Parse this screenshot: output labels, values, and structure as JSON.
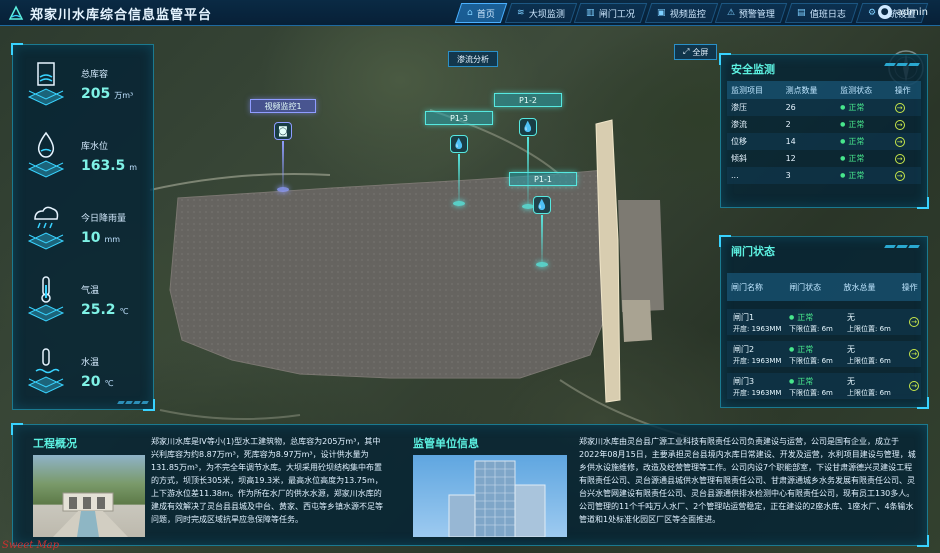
{
  "header": {
    "title": "郑家川水库综合信息监管平台",
    "nav": [
      {
        "label": "首页",
        "icon": "home-icon",
        "active": true
      },
      {
        "label": "大坝监测",
        "icon": "dam-icon",
        "active": false
      },
      {
        "label": "闸门工况",
        "icon": "gate-icon",
        "active": false
      },
      {
        "label": "视频监控",
        "icon": "video-icon",
        "active": false
      },
      {
        "label": "预警管理",
        "icon": "alarm-icon",
        "active": false
      },
      {
        "label": "值班日志",
        "icon": "log-icon",
        "active": false
      },
      {
        "label": "系统设置",
        "icon": "gear-icon",
        "active": false
      }
    ],
    "user": "admin"
  },
  "stats": [
    {
      "label": "总库容",
      "value": "205",
      "unit": "万m³",
      "icon": "reservoir-icon"
    },
    {
      "label": "库水位",
      "value": "163.5",
      "unit": "m",
      "icon": "water-level-icon"
    },
    {
      "label": "今日降雨量",
      "value": "10",
      "unit": "mm",
      "icon": "rain-icon"
    },
    {
      "label": "气温",
      "value": "25.2",
      "unit": "℃",
      "icon": "thermometer-icon"
    },
    {
      "label": "水温",
      "value": "20",
      "unit": "℃",
      "icon": "water-temp-icon"
    }
  ],
  "map": {
    "seepage_button": "渗流分析",
    "fullscreen_button": "全屏",
    "markers": [
      {
        "label": "视频监控1",
        "type": "video"
      },
      {
        "label": "P1-3",
        "type": "sensor"
      },
      {
        "label": "P1-2",
        "type": "sensor"
      },
      {
        "label": "P1-1",
        "type": "sensor"
      }
    ]
  },
  "safety": {
    "title": "安全监测",
    "headers": [
      "监测项目",
      "测点数量",
      "监测状态",
      "操作"
    ],
    "rows": [
      {
        "item": "渗压",
        "count": "26",
        "status": "正常"
      },
      {
        "item": "渗流",
        "count": "2",
        "status": "正常"
      },
      {
        "item": "位移",
        "count": "14",
        "status": "正常"
      },
      {
        "item": "倾斜",
        "count": "12",
        "status": "正常"
      },
      {
        "item": "...",
        "count": "3",
        "status": "正常"
      }
    ]
  },
  "gates": {
    "title": "闸门状态",
    "headers": [
      "闸门名称",
      "闸门状态",
      "放水总量",
      "操作"
    ],
    "rows": [
      {
        "name": "闸门1",
        "width": "开度: 1963MM",
        "status": "正常",
        "lower": "下限位置: 6m",
        "flow": "无",
        "flow_detail": "上限位置: 6m"
      },
      {
        "name": "闸门2",
        "width": "开度: 1963MM",
        "status": "正常",
        "lower": "下限位置: 6m",
        "flow": "无",
        "flow_detail": "上限位置: 6m"
      },
      {
        "name": "闸门3",
        "width": "开度: 1963MM",
        "status": "正常",
        "lower": "下限位置: 6m",
        "flow": "无",
        "flow_detail": "上限位置: 6m"
      }
    ]
  },
  "overview": {
    "title": "工程概况",
    "text": "郑家川水库是IV等小(1)型水工建筑物，总库容为205万m³，其中兴利库容为约8.87万m³，死库容为8.97万m³，设计供水量为131.85万m³，为不完全年调节水库。大坝采用砼坝结构集中布置的方式，坝顶长305米，坝高19.3米，最高水位高度为13.75m，上下游水位差11.38m。作为所在水厂的供水水源，郑家川水库的建成有效解决了灵台县县城及中台、黄家、西屯等乡镇水源不足等问题，同时完成区域抗旱应急保障等任务。"
  },
  "supervision": {
    "title": "监管单位信息",
    "text": "郑家川水库由灵台县广源工业科技有限责任公司负责建设与运营，公司是国有企业，成立于2022年08月15日，主要承担灵台县境内水库日常建设、开发及运营，水利项目建设与管理，城乡供水设施维修，改造及经营管理等工作。公司内设7个职能部室，下设甘肃源德兴灵建设工程有限责任公司、灵台源通县城供水管理有限责任公司、甘肃源通城乡水务发展有限责任公司、灵台兴水管网建设有限责任公司、灵台县源通供排水检测中心有限责任公司，现有员工130多人。公司管理的11个千吨万人水厂、2个管理站运营稳定，正在建设的2座水库、1座水厂、4条输水管道和1处标准化园区厂区等全面推进。"
  },
  "colors": {
    "accent": "#39d3ff",
    "title": "#5cf0e0",
    "value": "#7ff2e6",
    "ok": "#47e68c",
    "video_marker": "#8f9cff"
  },
  "watermark": "Sweet Map"
}
